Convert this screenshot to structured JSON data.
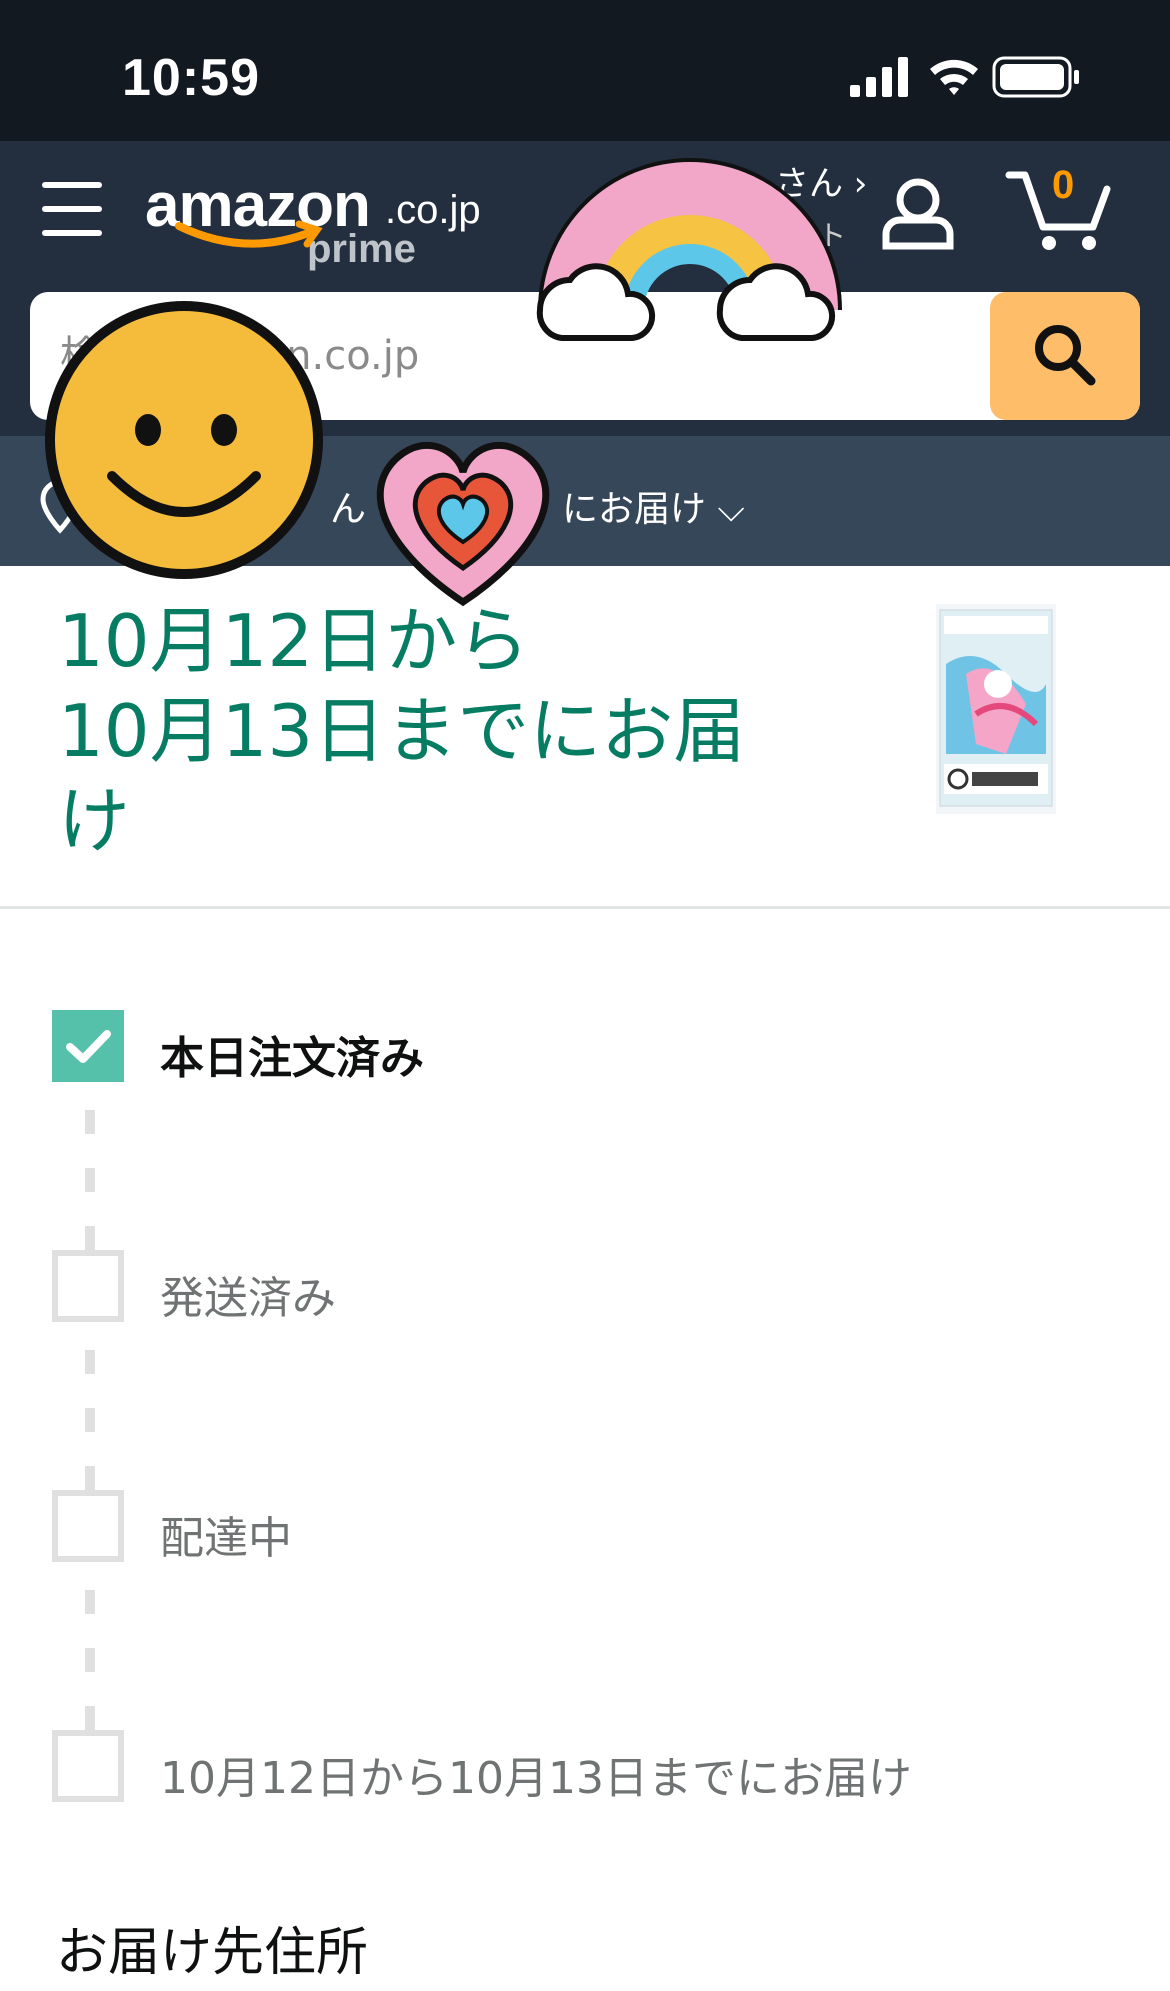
{
  "status_bar": {
    "time": "10:59"
  },
  "header": {
    "logo_text": "amazon",
    "logo_tld": ".co.jp",
    "logo_prime": "prime",
    "account_greeting": "さん ›",
    "account_sub": "ント",
    "cart_count": "0"
  },
  "search": {
    "placeholder": "検索 amazon.co.jp"
  },
  "location": {
    "text": "ん -",
    "suffix": "にお届け ⌵"
  },
  "order": {
    "heading_line1": "10月12日から",
    "heading_line2": "10月13日までにお届",
    "heading_line3": "け",
    "steps": [
      {
        "label": "本日注文済み",
        "done": true
      },
      {
        "label": "発送済み",
        "done": false
      },
      {
        "label": "配達中",
        "done": false
      },
      {
        "label": "10月12日から10月13日までにお届け",
        "done": false
      }
    ],
    "address_title": "お届け先住所"
  },
  "colors": {
    "header": "#232f3e",
    "accent": "#067d62",
    "check": "#56c1ab",
    "search_button": "#febd69",
    "cart": "#ff9900"
  },
  "icons": [
    "menu-icon",
    "user-icon",
    "cart-icon",
    "search-icon",
    "location-pin-icon",
    "check-icon"
  ]
}
